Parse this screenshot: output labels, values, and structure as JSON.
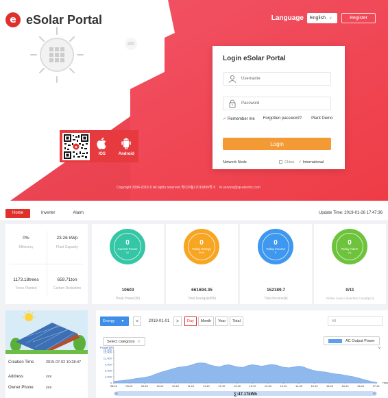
{
  "brand": {
    "name": "eSolar Portal",
    "logo_letter": "e"
  },
  "topbar": {
    "language_label": "Language",
    "language_value": "English",
    "register_label": "Register"
  },
  "apps": [
    {
      "label": "IOS",
      "icon": "apple-icon"
    },
    {
      "label": "Android",
      "icon": "android-icon"
    }
  ],
  "login": {
    "title": "Login eSolar Portal",
    "username_placeholder": "Username",
    "password_placeholder": "Password",
    "remember_label": "Remember me",
    "forgot_label": "Forgotten password?",
    "demo_label": "Plant Demo",
    "button_label": "Login",
    "node_label": "Network Node",
    "node_options": [
      "China",
      "International"
    ],
    "node_selected": "International"
  },
  "footer": {
    "copyright": "Copyright 2004-2018 © All rights reserved 粤ICP备17016899号-5",
    "email": "service@sp-electric.com"
  },
  "colors": {
    "brand_red": "#e0302e",
    "login_orange": "#f39a34",
    "kpi_teal": "#35c7a5",
    "kpi_orange": "#f7a623",
    "kpi_blue": "#3e98ef",
    "kpi_green": "#6dc43c",
    "chart_fill": "#8fb8ec"
  },
  "dash": {
    "nav": [
      {
        "label": "Home",
        "active": true
      },
      {
        "label": "Inverter",
        "active": false
      },
      {
        "label": "Alarm",
        "active": false
      }
    ],
    "update_time": "Update Time: 2019-01-26 17:47:36",
    "summary": [
      {
        "value": "0%",
        "label": "Efficiency"
      },
      {
        "value": "23.26 kWp",
        "label": "Plant Capacity"
      },
      {
        "value": "1173.18trees",
        "label": "Trees Planted"
      },
      {
        "value": "659.71ton",
        "label": "Carbon Reduction"
      }
    ],
    "kpis": [
      {
        "value": "0",
        "sub": "Current Power",
        "unit": "W",
        "total": "10603",
        "label": "Peak Power(W)"
      },
      {
        "value": "0",
        "sub": "Today Energy",
        "unit": "kWh",
        "total": "661694.35",
        "label": "Total Energy(kWh)"
      },
      {
        "value": "0",
        "sub": "Today Income",
        "unit": "¥",
        "total": "152189.7",
        "label": "Total Income(¥)"
      },
      {
        "value": "0",
        "sub": "Today Alarm",
        "unit": "(n)",
        "total": "0/11",
        "label": "Online count / Inverters Count(pcs)"
      }
    ],
    "plant": {
      "creation_label": "Creation Time",
      "creation_value": "2015-07-02 10:28:47",
      "address_label": "Address",
      "address_value": "xxx",
      "owner_label": "Owner Phone",
      "owner_value": "xxx"
    },
    "energy": {
      "selector_label": "Energy",
      "date": "2019-01-01",
      "periods": [
        {
          "label": "Day",
          "active": true
        },
        {
          "label": "Month",
          "active": false
        },
        {
          "label": "Year",
          "active": false
        },
        {
          "label": "Total",
          "active": false
        }
      ],
      "search_placeholder": "All",
      "category_label": "Select categorys",
      "legend_label": "AC Output Power",
      "total_label": "∑:47.17kWh"
    }
  },
  "chart_data": {
    "type": "area",
    "ylabel": "Power(W)",
    "yaxis_right_label": "V",
    "ylim": [
      0,
      16000
    ],
    "yticks": [
      "16,000",
      "15,000",
      "12,000",
      "9,000",
      "6,000",
      "3,000",
      "0"
    ],
    "categories": [
      "08:40",
      "09:10",
      "09:40",
      "10:10",
      "10:40",
      "11:10",
      "11:40",
      "12:10",
      "12:40",
      "13:10",
      "13:40",
      "14:10",
      "14:40",
      "15:10",
      "15:40",
      "16:10",
      "16:40",
      "17:10"
    ],
    "x_hours": [
      8.67,
      8.8,
      8.95,
      9.1,
      9.25,
      9.4,
      9.55,
      9.7,
      9.85,
      10.0,
      10.15,
      10.3,
      10.45,
      10.6,
      10.75,
      10.9,
      11.05,
      11.2,
      11.35,
      11.5,
      11.65,
      11.8,
      11.95,
      12.1,
      12.25,
      12.4,
      12.55,
      12.7,
      12.85,
      13.0,
      13.15,
      13.3,
      13.45,
      13.6,
      13.75,
      13.9,
      14.05,
      14.2,
      14.35,
      14.5,
      14.65,
      14.8,
      14.95,
      15.1,
      15.25,
      15.4,
      15.55,
      15.7,
      15.85,
      16.0,
      16.15,
      16.3,
      16.45,
      16.6,
      16.75,
      16.9,
      17.05,
      17.2
    ],
    "series": [
      {
        "name": "AC Output Power",
        "values": [
          800,
          1000,
          1200,
          1500,
          1800,
          2200,
          2500,
          2800,
          3300,
          4200,
          5000,
          5700,
          6300,
          7000,
          7600,
          7900,
          8200,
          8800,
          9600,
          9800,
          9600,
          8700,
          8200,
          7900,
          8600,
          8900,
          8300,
          7800,
          7600,
          8400,
          8900,
          8600,
          8200,
          8500,
          9000,
          8800,
          8200,
          7600,
          7400,
          7800,
          8200,
          7900,
          7000,
          6300,
          5800,
          5500,
          5300,
          4800,
          4400,
          4200,
          3800,
          3400,
          3000,
          2400,
          1800,
          1200,
          600,
          200
        ]
      }
    ],
    "x_unit_label": "Hour",
    "total": "∑:47.17kWh"
  }
}
